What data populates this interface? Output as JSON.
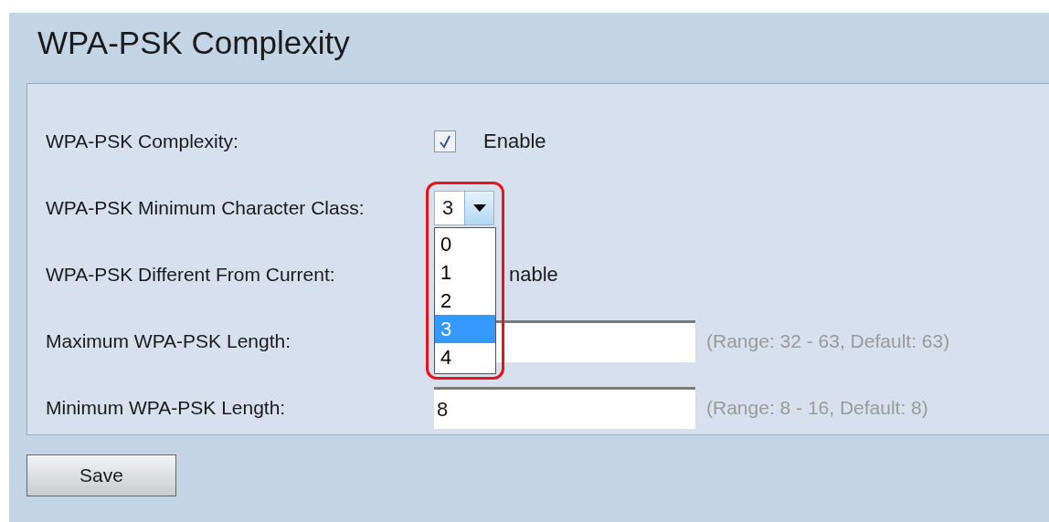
{
  "title": "WPA-PSK Complexity",
  "rows": [
    {
      "kind": "checkbox",
      "label": "WPA-PSK Complexity:",
      "checked": true,
      "option": "Enable"
    },
    {
      "kind": "select",
      "label": "WPA-PSK Minimum Character Class:",
      "value": "3",
      "expanded": true,
      "highlighted": true,
      "options": [
        {
          "label": "0",
          "selected": false
        },
        {
          "label": "1",
          "selected": false
        },
        {
          "label": "2",
          "selected": false
        },
        {
          "label": "3",
          "selected": true
        },
        {
          "label": "4",
          "selected": false
        }
      ]
    },
    {
      "kind": "covered",
      "label": "WPA-PSK Different From Current:",
      "option": "nable"
    },
    {
      "kind": "text",
      "label": "Maximum WPA-PSK Length:",
      "hint": "(Range: 32 - 63, Default: 63)"
    },
    {
      "kind": "text",
      "label": "Minimum WPA-PSK Length:",
      "value": "8",
      "hint": "(Range: 8 - 16, Default: 8)"
    }
  ],
  "save": "Save"
}
